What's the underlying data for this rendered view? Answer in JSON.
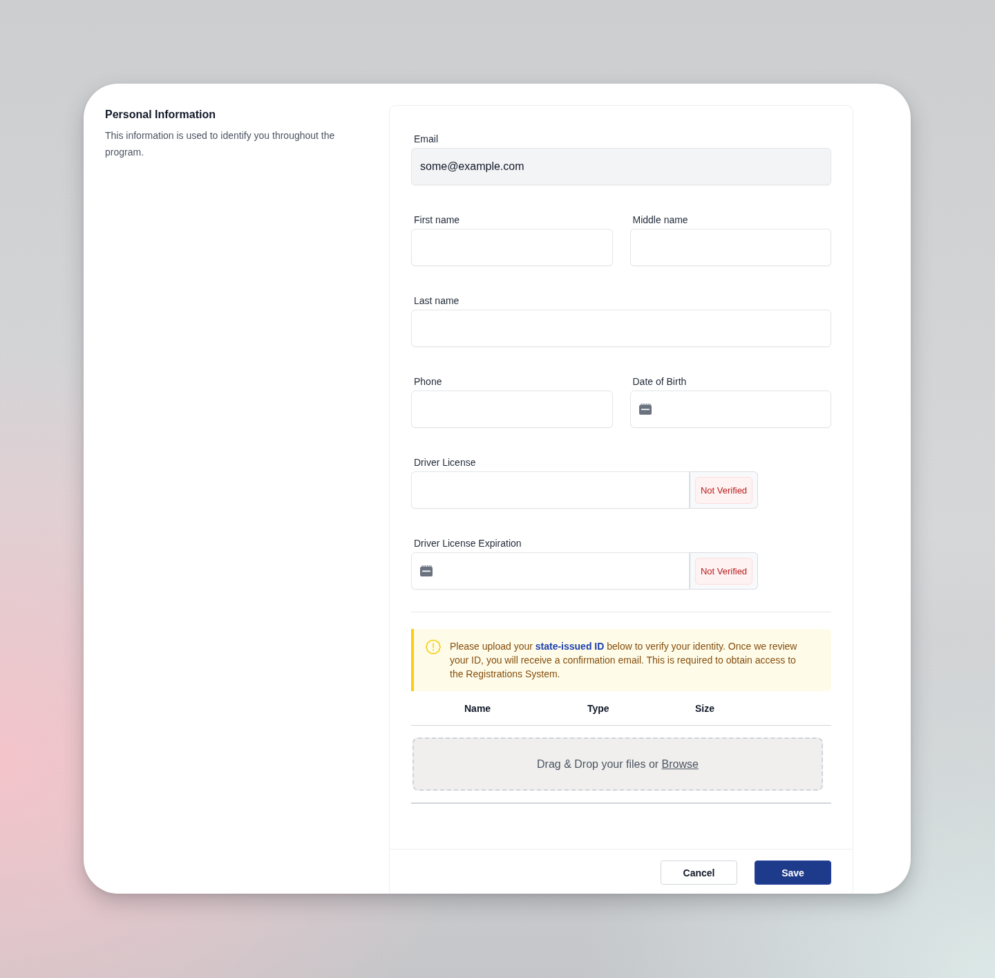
{
  "section": {
    "title": "Personal Information",
    "description": "This information is used to identify you throughout the program."
  },
  "field_rows": [
    {
      "fields": [
        {
          "label": "Email",
          "kind": "text",
          "value": "some@example.com",
          "disabled": true
        }
      ]
    },
    {
      "fields": [
        {
          "label": "First name",
          "kind": "text",
          "disabled": false
        },
        {
          "label": "Middle name",
          "kind": "text",
          "disabled": false
        }
      ]
    },
    {
      "fields": [
        {
          "label": "Last name",
          "kind": "text",
          "disabled": false
        }
      ]
    },
    {
      "fields": [
        {
          "label": "Phone",
          "kind": "text",
          "disabled": false
        },
        {
          "label": "Date of Birth",
          "kind": "date",
          "disabled": false
        }
      ]
    },
    {
      "fields": [
        {
          "label": "Driver License",
          "kind": "text",
          "disabled": false,
          "verification": {
            "label": "Not Verified",
            "verified": false
          }
        }
      ]
    },
    {
      "fields": [
        {
          "label": "Driver License Expiration",
          "kind": "date",
          "disabled": false,
          "verification": {
            "label": "Not Verified",
            "verified": false
          }
        }
      ]
    }
  ],
  "notice": {
    "text_before": "Please upload your",
    "link": "state-issued ID",
    "text_after": "below to verify your identity. Once we review your ID, you will receive a confirmation email. This is required to obtain access to the Registrations System."
  },
  "files": {
    "columns": [
      "Name",
      "Type",
      "Size"
    ],
    "dropzone": {
      "prompt": "Drag & Drop your files or",
      "link": "Browse"
    }
  },
  "buttons": [
    {
      "label": "Cancel",
      "kind": "secondary"
    },
    {
      "label": "Save",
      "kind": "primary"
    }
  ]
}
